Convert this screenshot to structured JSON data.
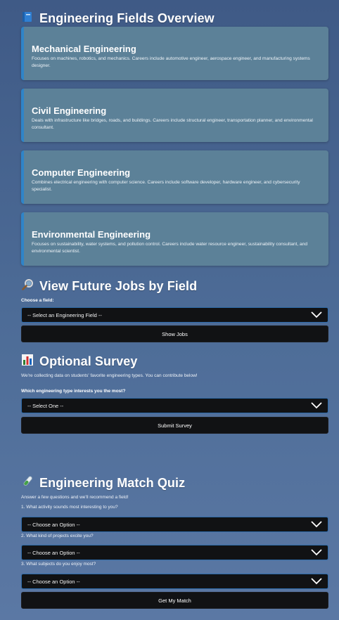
{
  "overview": {
    "icon": "book-icon",
    "title": "Engineering Fields Overview",
    "cards": [
      {
        "title": "Mechanical Engineering",
        "desc": "Focuses on machines, robotics, and mechanics. Careers include automotive engineer, aerospace engineer, and manufacturing systems designer."
      },
      {
        "title": "Civil Engineering",
        "desc": "Deals with infrastructure like bridges, roads, and buildings. Careers include structural engineer, transportation planner, and environmental consultant."
      },
      {
        "title": "Computer Engineering",
        "desc": "Combines electrical engineering with computer science. Careers include software developer, hardware engineer, and cybersecurity specialist."
      },
      {
        "title": "Environmental Engineering",
        "desc": "Focuses on sustainability, water systems, and pollution control. Careers include water resource engineer, sustainability consultant, and environmental scientist."
      }
    ]
  },
  "jobs": {
    "icon": "magnifier-icon",
    "title": "View Future Jobs by Field",
    "label": "Choose a field:",
    "select_value": "-- Select an Engineering Field --",
    "button": "Show Jobs"
  },
  "survey": {
    "icon": "bar-chart-icon",
    "title": "Optional Survey",
    "intro": "We're collecting data on students' favorite engineering types. You can contribute below!",
    "question": "Which engineering type interests you the most?",
    "select_value": "-- Select One --",
    "button": "Submit Survey"
  },
  "quiz": {
    "icon": "test-tube-icon",
    "title": "Engineering Match Quiz",
    "intro": "Answer a few questions and we'll recommend a field!",
    "questions": [
      {
        "text": "1. What activity sounds most interesting to you?",
        "select_value": "-- Choose an Option --"
      },
      {
        "text": "2. What kind of projects excite you?",
        "select_value": "-- Choose an Option --"
      },
      {
        "text": "3. What subjects do you enjoy most?",
        "select_value": "-- Choose an Option --"
      }
    ],
    "button": "Get My Match"
  }
}
